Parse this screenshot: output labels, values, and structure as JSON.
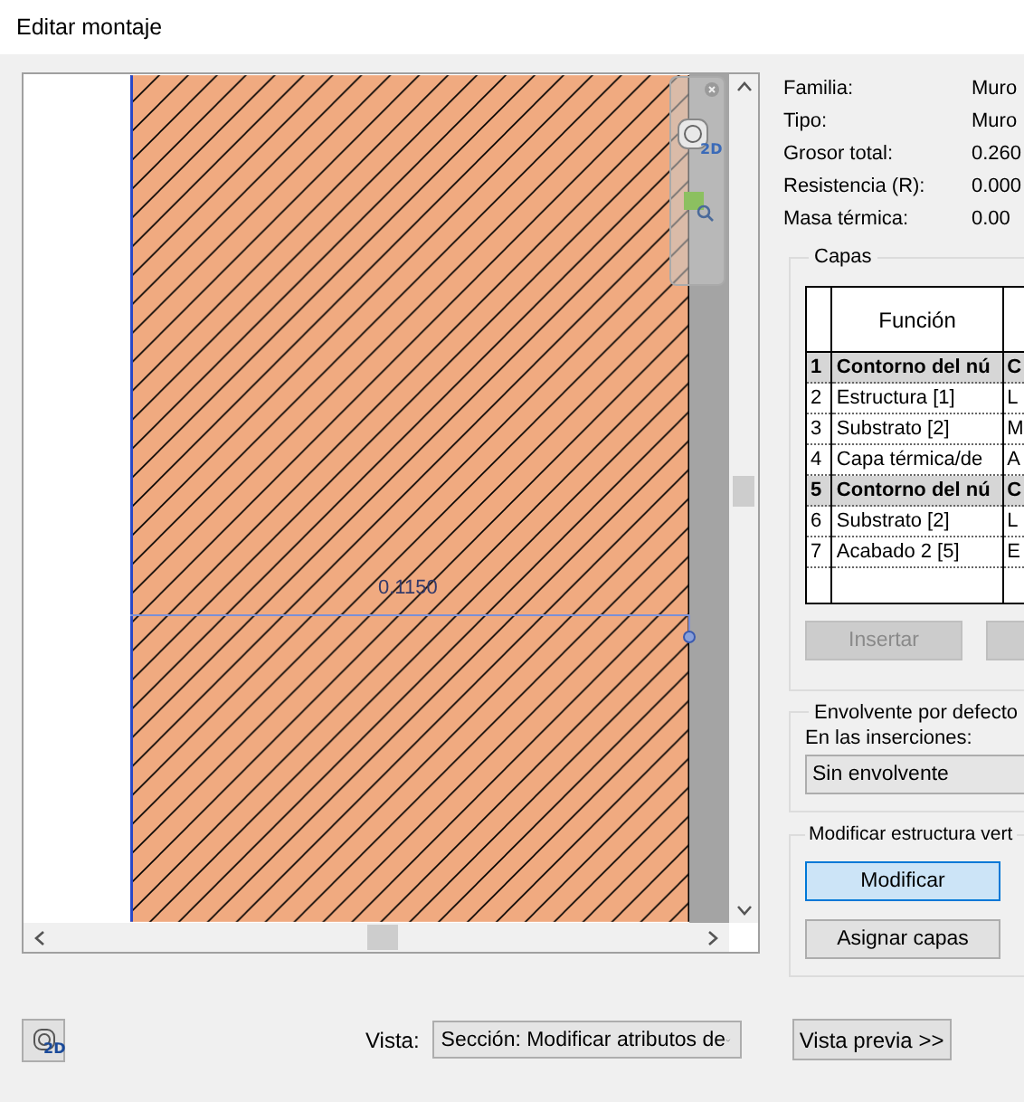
{
  "window": {
    "title": "Editar montaje"
  },
  "preview": {
    "dimension": "0.1150",
    "nav_badge": "2D"
  },
  "properties": [
    {
      "label": "Familia:",
      "value": "Muro"
    },
    {
      "label": "Tipo:",
      "value": "Muro"
    },
    {
      "label": "Grosor total:",
      "value": "0.260"
    },
    {
      "label": "Resistencia (R):",
      "value": "0.000"
    },
    {
      "label": "Masa térmica:",
      "value": "0.00"
    }
  ],
  "layers": {
    "title": "Capas",
    "columns": [
      "Función"
    ],
    "rows": [
      {
        "number": "1",
        "function": "Contorno del nú",
        "column_2": "C",
        "kind": "boundary"
      },
      {
        "number": "2",
        "function": "Estructura [1]",
        "column_2": "L",
        "kind": "layer"
      },
      {
        "number": "3",
        "function": "Substrato [2]",
        "column_2": "M",
        "kind": "layer"
      },
      {
        "number": "4",
        "function": "Capa térmica/de",
        "column_2": "A",
        "kind": "layer"
      },
      {
        "number": "5",
        "function": "Contorno del nú",
        "column_2": "C",
        "kind": "boundary"
      },
      {
        "number": "6",
        "function": "Substrato [2]",
        "column_2": "L",
        "kind": "layer"
      },
      {
        "number": "7",
        "function": "Acabado 2 [5]",
        "column_2": "E",
        "kind": "layer"
      }
    ]
  },
  "layer_buttons": [
    {
      "label": "Insertar",
      "disabled": true
    },
    {
      "disabled": true
    }
  ],
  "wrap": {
    "title": "Envolvente por defecto",
    "label": "En las inserciones:",
    "value": "Sin envolvente"
  },
  "vertical": {
    "title": "Modificar estructura vert",
    "buttons": [
      {
        "label": "Modificar",
        "selected": true
      },
      {
        "label": "Asignar capas",
        "selected": false
      }
    ]
  },
  "footer": {
    "badge": "2D",
    "view_label": "Vista:",
    "view_value": "Sección: Modificar atributos de",
    "preview_button": "Vista previa >>"
  }
}
